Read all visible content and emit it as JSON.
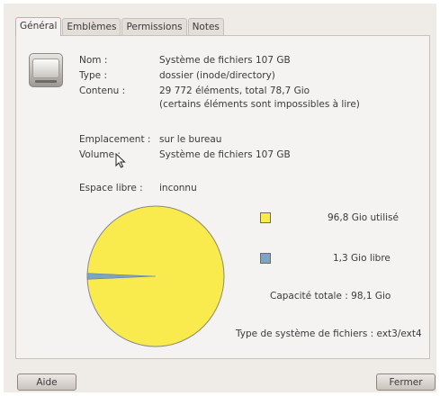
{
  "tabs": [
    {
      "label": "Général",
      "active": true
    },
    {
      "label": "Emblèmes",
      "active": false
    },
    {
      "label": "Permissions",
      "active": false
    },
    {
      "label": "Notes",
      "active": false
    }
  ],
  "properties": {
    "name_label": "Nom :",
    "name_value": "Système de fichiers 107 GB",
    "type_label": "Type :",
    "type_value": "dossier (inode/directory)",
    "contents_label": "Contenu :",
    "contents_value_line1": "29 772 éléments, total 78,7 Gio",
    "contents_value_line2": "(certains éléments sont impossibles à lire)",
    "location_label": "Emplacement :",
    "location_value": "sur le bureau",
    "volume_label": "Volume :",
    "volume_value": "Système de fichiers 107 GB",
    "free_space_label": "Espace libre :",
    "free_space_value": "inconnu"
  },
  "usage": {
    "used_label": "96,8 Gio utilisé",
    "free_label": "1,3 Gio libre",
    "total_label": "Capacité totale : 98,1 Gio",
    "fs_type_label": "Type de système de fichiers : ext3/ext4",
    "used_gio": 96.8,
    "free_gio": 1.3,
    "total_gio": 98.1,
    "colors": {
      "used": "#f9eb4e",
      "free": "#7ea3c7",
      "outline": "#8a8a7a"
    }
  },
  "buttons": {
    "help_label": "Aide",
    "close_label": "Fermer"
  },
  "icons": {
    "drive": "harddisk-icon",
    "cursor": "mouse-pointer-icon"
  }
}
